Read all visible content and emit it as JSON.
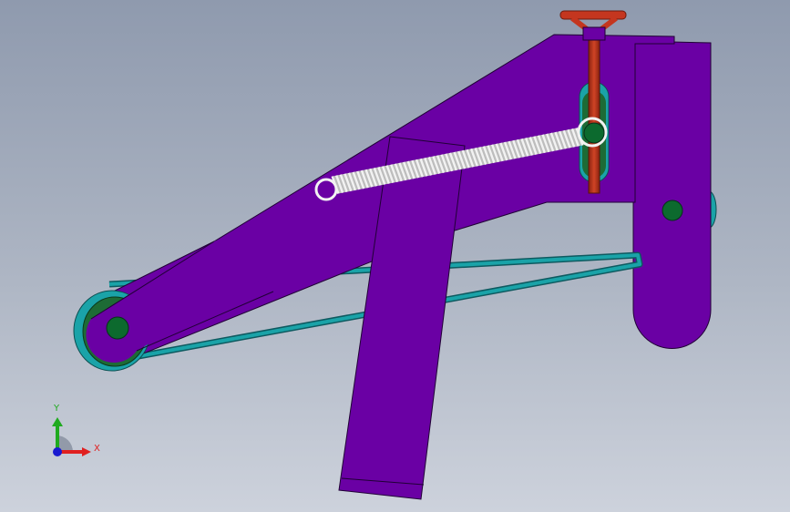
{
  "viewport": {
    "background_top": "#8f9aae",
    "background_bottom": "#cdd2dc"
  },
  "model": {
    "frame_color": "#6a00a4",
    "edge_color": "#200035",
    "belt_color": "#1aa3a8",
    "pulley_color": "#1d6b35",
    "pin_color": "#0c6a2e",
    "spring_color": "#f2f2f2",
    "handwheel_color": "#c4361f",
    "parts": [
      "main-arm",
      "upright-column",
      "swing-leg",
      "drive-belt",
      "pulley",
      "tension-spring",
      "adjustment-handwheel",
      "pivot-pins"
    ]
  },
  "triad": {
    "x_label": "X",
    "y_label": "Y",
    "x_color": "#e02020",
    "y_color": "#1faa1f",
    "z_color": "#1a1ad0"
  }
}
